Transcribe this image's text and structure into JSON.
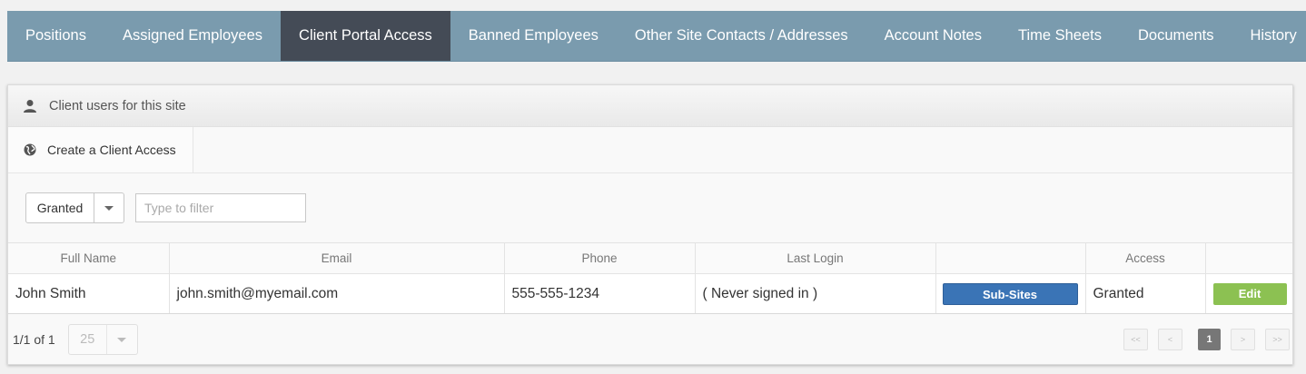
{
  "tabs": [
    {
      "label": "Positions"
    },
    {
      "label": "Assigned Employees"
    },
    {
      "label": "Client Portal Access"
    },
    {
      "label": "Banned Employees"
    },
    {
      "label": "Other Site Contacts / Addresses"
    },
    {
      "label": "Account Notes"
    },
    {
      "label": "Time Sheets"
    },
    {
      "label": "Documents"
    },
    {
      "label": "History"
    }
  ],
  "active_tab": "Client Portal Access",
  "panel": {
    "title": "Client users for this site",
    "title_icon": "user-icon",
    "create_button": "Create a Client Access",
    "create_icon": "globe-icon"
  },
  "filter": {
    "status_value": "Granted",
    "placeholder": "Type to filter"
  },
  "table": {
    "columns": [
      "Full Name",
      "Email",
      "Phone",
      "Last Login",
      "",
      "Access",
      ""
    ],
    "rows": [
      {
        "full_name": "John Smith",
        "email": "john.smith@myemail.com",
        "phone": "555-555-1234",
        "last_login": "( Never signed in )",
        "subsites_label": "Sub-Sites",
        "access": "Granted",
        "edit_label": "Edit"
      }
    ]
  },
  "pagination": {
    "info": "1/1 of 1",
    "page_size": "25",
    "first": "<<",
    "prev": "<",
    "current": "1",
    "next": ">",
    "last": ">>"
  },
  "colors": {
    "tab_bar": "#7a9bae",
    "tab_active": "#444b56",
    "subsites_button": "#3a74b6",
    "edit_button": "#8cc152"
  }
}
